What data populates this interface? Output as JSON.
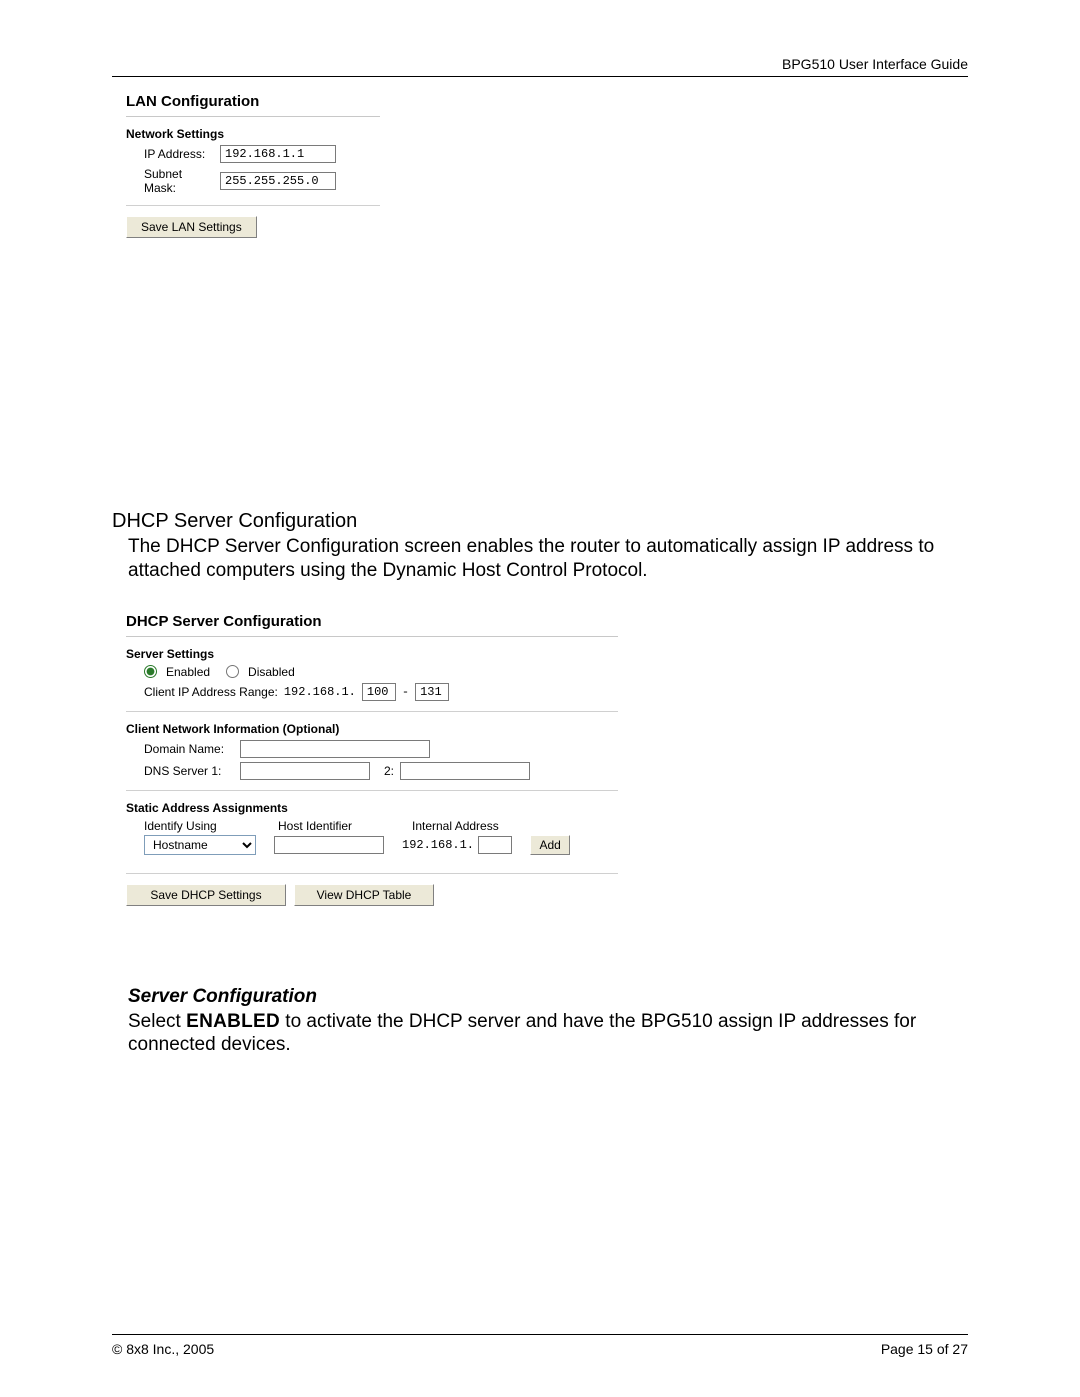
{
  "header": {
    "title": "BPG510 User Interface Guide"
  },
  "lan": {
    "title": "LAN Configuration",
    "section": "Network Settings",
    "ip_label": "IP Address:",
    "ip_value": "192.168.1.1",
    "mask_label": "Subnet Mask:",
    "mask_value": "255.255.255.0",
    "save_btn": "Save LAN Settings"
  },
  "dhcp_heading": "DHCP Server Configuration",
  "dhcp_intro": "The DHCP Server Configuration screen enables the router to automatically assign IP address to attached computers using the Dynamic Host Control Protocol.",
  "dhcp": {
    "title": "DHCP Server Configuration",
    "server_settings": "Server Settings",
    "enabled": "Enabled",
    "disabled": "Disabled",
    "range_label": "Client IP Address Range:",
    "range_prefix": "192.168.1.",
    "range_from": "100",
    "range_dash": "-",
    "range_to": "131",
    "client_net": "Client Network Information (Optional)",
    "domain_label": "Domain Name:",
    "domain_value": "",
    "dns1_label": "DNS Server 1:",
    "dns1_value": "",
    "dns2_label": "2:",
    "dns2_value": "",
    "static_title": "Static Address Assignments",
    "col_identify": "Identify Using",
    "col_hostid": "Host Identifier",
    "col_internal": "Internal Address",
    "identify_value": "Hostname",
    "internal_prefix": "192.168.1.",
    "add_btn": "Add",
    "save_btn": "Save DHCP Settings",
    "view_btn": "View DHCP Table"
  },
  "server_cfg": {
    "title": "Server Configuration",
    "text_pre": "Select ",
    "text_enabled": "ENABLED",
    "text_post": " to activate the DHCP server and have the BPG510 assign IP addresses for connected devices."
  },
  "footer": {
    "copyright": "© 8x8 Inc., 2005",
    "page": "Page 15 of 27"
  }
}
